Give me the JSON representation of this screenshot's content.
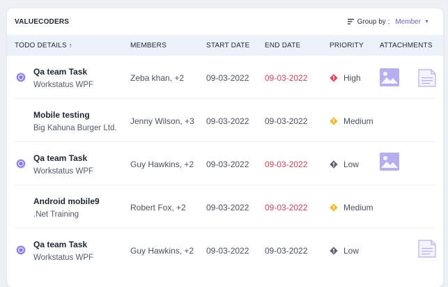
{
  "header": {
    "org_name": "VALUECODERS",
    "group_by_label": "Group by :",
    "group_by_value": "Member",
    "lines_icon": "filter-lines-icon",
    "caret_icon": "caret-down-icon"
  },
  "columns": {
    "todo": "TODO DETAILS",
    "sort_arrow": "↑",
    "members": "MEMBERS",
    "start": "START DATE",
    "end": "END DATE",
    "priority": "PRIORITY",
    "attachments": "ATTACHMENTS"
  },
  "colors": {
    "accent": "#6b63d8",
    "overdue": "#e0445a",
    "high": "#e0445a",
    "medium": "#f2b928",
    "low": "#5e6272",
    "status_ring": "#8a7fe0"
  },
  "rows": [
    {
      "title": "Qa team Task",
      "sub": "Workstatus WPF",
      "members": "Zeba khan, +2",
      "start": "09-03-2022",
      "end": "09-03-2022",
      "end_overdue": true,
      "priority": "High",
      "priority_icon": "priority-high-icon",
      "status_icon": "status-ring-icon",
      "attachments": [
        "image-icon",
        "document-icon"
      ]
    },
    {
      "title": "Mobile testing",
      "sub": "Big Kahuna Burger Ltd.",
      "members": "Jenny Wilson, +3",
      "start": "09-03-2022",
      "end": "09-03-2022",
      "end_overdue": false,
      "priority": "Medium",
      "priority_icon": "priority-medium-icon",
      "status_icon": "",
      "attachments": []
    },
    {
      "title": "Qa team Task",
      "sub": "Workstatus WPF",
      "members": "Guy Hawkins, +2",
      "start": "09-03-2022",
      "end": "09-03-2022",
      "end_overdue": true,
      "priority": "Low",
      "priority_icon": "priority-low-icon",
      "status_icon": "status-ring-icon",
      "attachments": [
        "image-icon"
      ]
    },
    {
      "title": "Android mobile9",
      "sub": ".Net Training",
      "members": "Robert Fox, +2",
      "start": "09-03-2022",
      "end": "09-03-2022",
      "end_overdue": true,
      "priority": "Medium",
      "priority_icon": "priority-medium-icon",
      "status_icon": "",
      "attachments": []
    },
    {
      "title": "Qa team Task",
      "sub": "Workstatus WPF",
      "members": "Guy Hawkins, +2",
      "start": "09-03-2022",
      "end": "09-03-2022",
      "end_overdue": false,
      "priority": "Low",
      "priority_icon": "priority-low-icon",
      "status_icon": "status-ring-icon",
      "attachments": [
        "document-icon"
      ]
    }
  ]
}
